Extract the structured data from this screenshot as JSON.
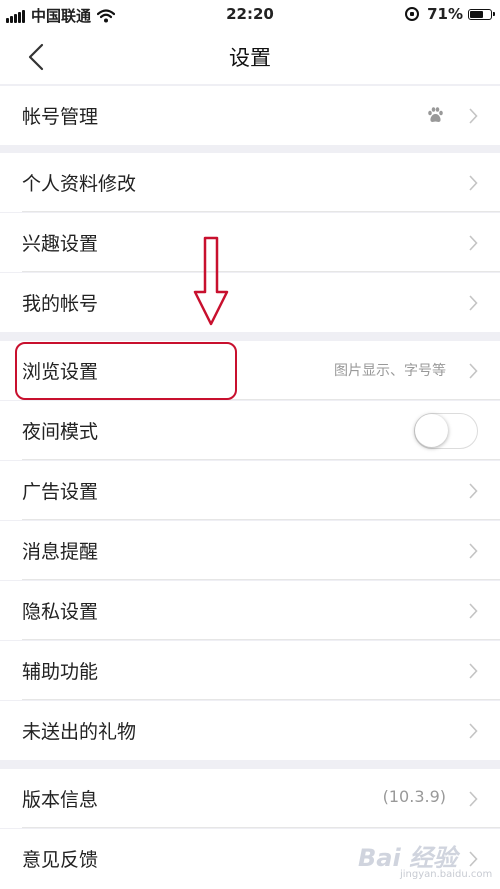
{
  "status_bar": {
    "carrier": "中国联通",
    "time": "22:20",
    "battery_percent": "71%",
    "battery_level": 0.71,
    "icons": [
      "signal-icon",
      "wifi-icon",
      "orientation-lock-icon",
      "battery-icon"
    ]
  },
  "nav": {
    "title": "设置",
    "back_icon": "chevron-left-icon"
  },
  "sections": [
    {
      "rows": [
        {
          "label": "帐号管理",
          "icon": "baidu-paw-icon",
          "chevron": true
        }
      ]
    },
    {
      "rows": [
        {
          "label": "个人资料修改",
          "chevron": true
        },
        {
          "label": "兴趣设置",
          "chevron": true
        },
        {
          "label": "我的帐号",
          "chevron": true
        }
      ]
    },
    {
      "rows": [
        {
          "label": "浏览设置",
          "value": "图片显示、字号等",
          "chevron": true,
          "highlighted": true
        },
        {
          "label": "夜间模式",
          "toggle": false
        },
        {
          "label": "广告设置",
          "chevron": true
        },
        {
          "label": "消息提醒",
          "chevron": true
        },
        {
          "label": "隐私设置",
          "chevron": true
        },
        {
          "label": "辅助功能",
          "chevron": true
        },
        {
          "label": "未送出的礼物",
          "chevron": true
        }
      ]
    },
    {
      "rows": [
        {
          "label": "版本信息",
          "value": "(10.3.9)",
          "chevron": true
        },
        {
          "label": "意见反馈",
          "chevron": true
        }
      ]
    }
  ],
  "annotation": {
    "highlight_color": "#c8102e",
    "arrow_color": "#c8102e"
  },
  "watermark": {
    "main": "Bai 经验",
    "sub": "jingyan.baidu.com"
  }
}
